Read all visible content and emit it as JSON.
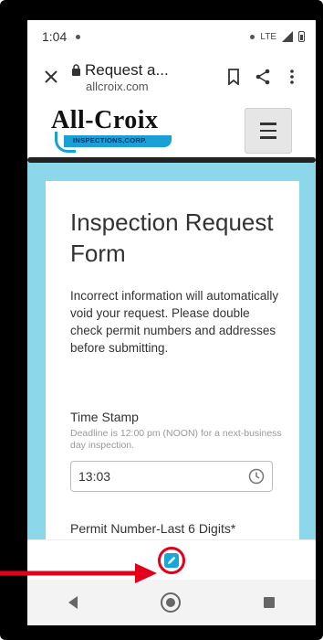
{
  "status": {
    "time": "1:04",
    "network": "LTE"
  },
  "browser": {
    "title": "Request a...",
    "domain": "allcroix.com"
  },
  "site": {
    "logo_text": "All-Croix",
    "logo_subtext": "INSPECTIONS,CORP."
  },
  "form": {
    "title": "Inspection Request Form",
    "warning": "Incorrect information will automatically void your request. Please double check permit numbers and addresses before submitting.",
    "time_stamp_label": "Time Stamp",
    "time_stamp_help": "Deadline  is 12:00 pm (NOON) for a next-business day inspection.",
    "time_stamp_value": "13:03",
    "permit_label": "Permit Number-Last 6 Digits*"
  },
  "colors": {
    "accent": "#8dd7ea",
    "logo_blue": "#1aa0d6",
    "annotation_red": "#e3001b"
  },
  "icons": [
    "close-icon",
    "lock-icon",
    "bookmark-icon",
    "share-icon",
    "more-icon",
    "menu-icon",
    "clock-icon",
    "edit-icon",
    "nav-back-icon",
    "nav-home-icon",
    "nav-recents-icon"
  ]
}
